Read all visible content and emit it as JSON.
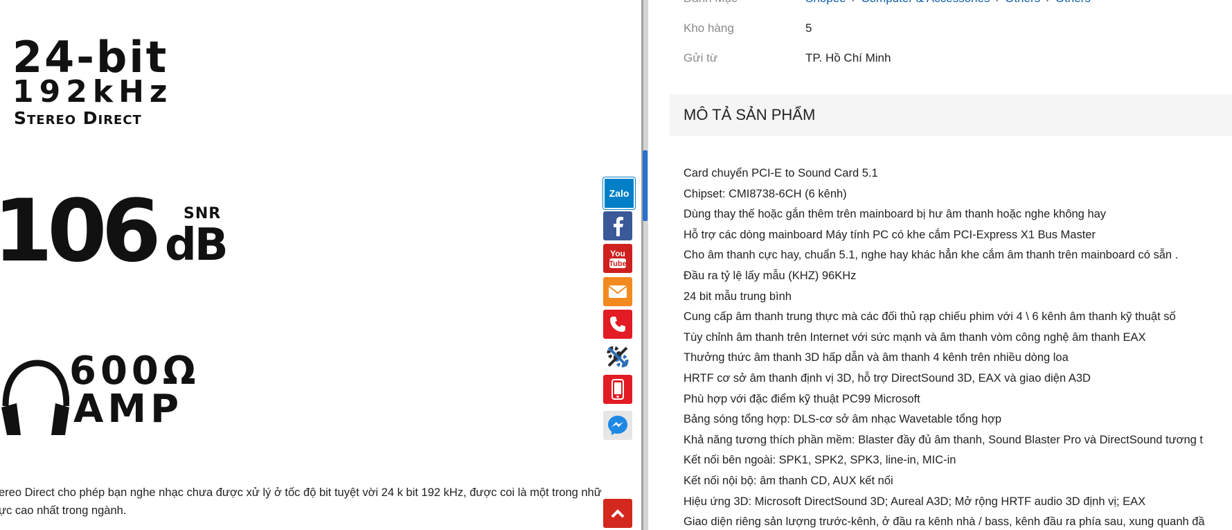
{
  "left": {
    "logo_bit": {
      "line1": "24-bit",
      "line2": "192kHz",
      "line3": "Stereo Direct"
    },
    "logo_snr": {
      "number": "106",
      "snr": "SNR",
      "db": "dB"
    },
    "logo_amp": {
      "ohm": "600Ω",
      "amp": "AMP"
    },
    "desc_line1": "ereo Direct cho phép bạn nghe nhạc chưa được xử lý ở tốc độ bit tuyệt vời 24 k bit 192 kHz, được coi là một trong nhữ",
    "desc_line2": "ực cao nhất trong ngành."
  },
  "social": {
    "zalo": "Zalo"
  },
  "specs": {
    "category_label": "Danh Mục",
    "breadcrumb": [
      "Shopee",
      "Computer & Accessories",
      "Others",
      "Others"
    ],
    "breadcrumb_sep": "›",
    "stock_label": "Kho hàng",
    "stock_value": "5",
    "from_label": "Gửi từ",
    "from_value": "TP. Hồ Chí Minh"
  },
  "description": {
    "title": "MÔ TẢ SẢN PHẨM",
    "lines": [
      "Card chuyển PCI-E to Sound Card 5.1",
      "Chipset: CMI8738-6CH (6 kênh)",
      "Dùng thay thế hoặc gắn thêm trên mainboard bị hư âm thanh hoặc nghe không hay",
      "Hỗ trợ các dòng mainboard Máy tính PC có khe cắm PCI-Express X1 Bus Master",
      "Cho âm thanh cực hay, chuẩn 5.1, nghe hay khác hẳn khe cắm âm thanh trên mainboard có sẵn .",
      "Đầu ra tỷ lệ lấy mẫu (KHZ) 96KHz",
      "24 bit mẫu trung bình",
      "Cung cấp âm thanh trung thực mà các đối thủ rạp chiếu phim với 4 \\ 6 kênh âm thanh kỹ thuật số",
      "Tùy chỉnh âm thanh trên Internet với sức mạnh và âm thanh vòm công nghệ âm thanh EAX",
      "Thưởng thức âm thanh 3D hấp dẫn và âm thanh 4 kênh trên nhiều dòng loa",
      "HRTF cơ sở âm thanh định vị 3D, hỗ trợ DirectSound 3D, EAX và giao diện A3D",
      "Phù hợp với đặc điểm kỹ thuật PC99 Microsoft",
      "Bảng sóng tổng hợp: DLS-cơ sở âm nhạc Wavetable tổng hợp",
      "Khả năng tương thích phần mềm: Blaster đầy đủ âm thanh, Sound Blaster Pro và DirectSound tương t",
      "Kết nối bên ngoài: SPK1, SPK2, SPK3, line-in, MIC-in",
      "Kết nối nội bộ: âm thanh CD, AUX kết nối",
      "Hiệu ứng 3D: Microsoft DirectSound 3D; Aureal A3D; Mở rộng HRTF audio 3D định vị; EAX",
      "Giao diện riêng sản lượng trước-kênh, ở đầu ra kênh nhà / bass, kênh đầu ra phía sau, xung quanh đầ"
    ]
  }
}
